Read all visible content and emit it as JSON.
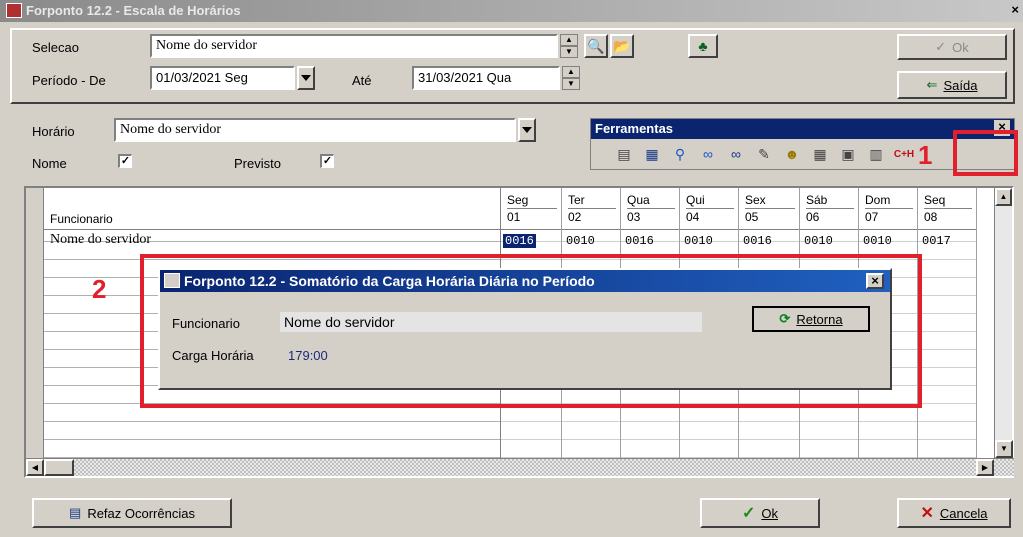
{
  "window": {
    "title": "Forponto 12.2 - Escala de Horários"
  },
  "top": {
    "selecao_label": "Selecao",
    "selecao_value": "Nome do servidor",
    "periodo_label": "Período - De",
    "periodo_de": "01/03/2021 Seg",
    "ate_label": "Até",
    "periodo_ate": "31/03/2021 Qua",
    "ok_label": "Ok",
    "saida_label": "Saída"
  },
  "filters": {
    "horario_label": "Horário",
    "horario_value": "Nome do servidor",
    "nome_label": "Nome",
    "previsto_label": "Previsto",
    "nome_checked": "✓",
    "previsto_checked": "✓"
  },
  "toolbar": {
    "title": "Ferramentas",
    "close": "×",
    "last_icon": "C+H"
  },
  "grid": {
    "first_col": "Funcionario",
    "columns": [
      {
        "day": "Seg",
        "num": "01"
      },
      {
        "day": "Ter",
        "num": "02"
      },
      {
        "day": "Qua",
        "num": "03"
      },
      {
        "day": "Qui",
        "num": "04"
      },
      {
        "day": "Sex",
        "num": "05"
      },
      {
        "day": "Sáb",
        "num": "06"
      },
      {
        "day": "Dom",
        "num": "07"
      },
      {
        "day": "Seq",
        "num": "08"
      }
    ],
    "row_name": "Nome do servidor",
    "row_values": [
      "0016",
      "0010",
      "0016",
      "0010",
      "0016",
      "0010",
      "0010",
      "0017"
    ]
  },
  "dialog": {
    "title": "Forponto 12.2 - Somatório da Carga Horária Diária no Período",
    "func_label": "Funcionario",
    "func_value": "Nome do servidor",
    "carga_label": "Carga Horária",
    "carga_value": "179:00",
    "retorna_label": "Retorna",
    "close": "×"
  },
  "bottom": {
    "refaz_label": "Refaz Ocorrências",
    "ok_label": "Ok",
    "cancela_label": "Cancela"
  },
  "annotations": {
    "one": "1",
    "two": "2",
    "color": "#e0202c"
  }
}
